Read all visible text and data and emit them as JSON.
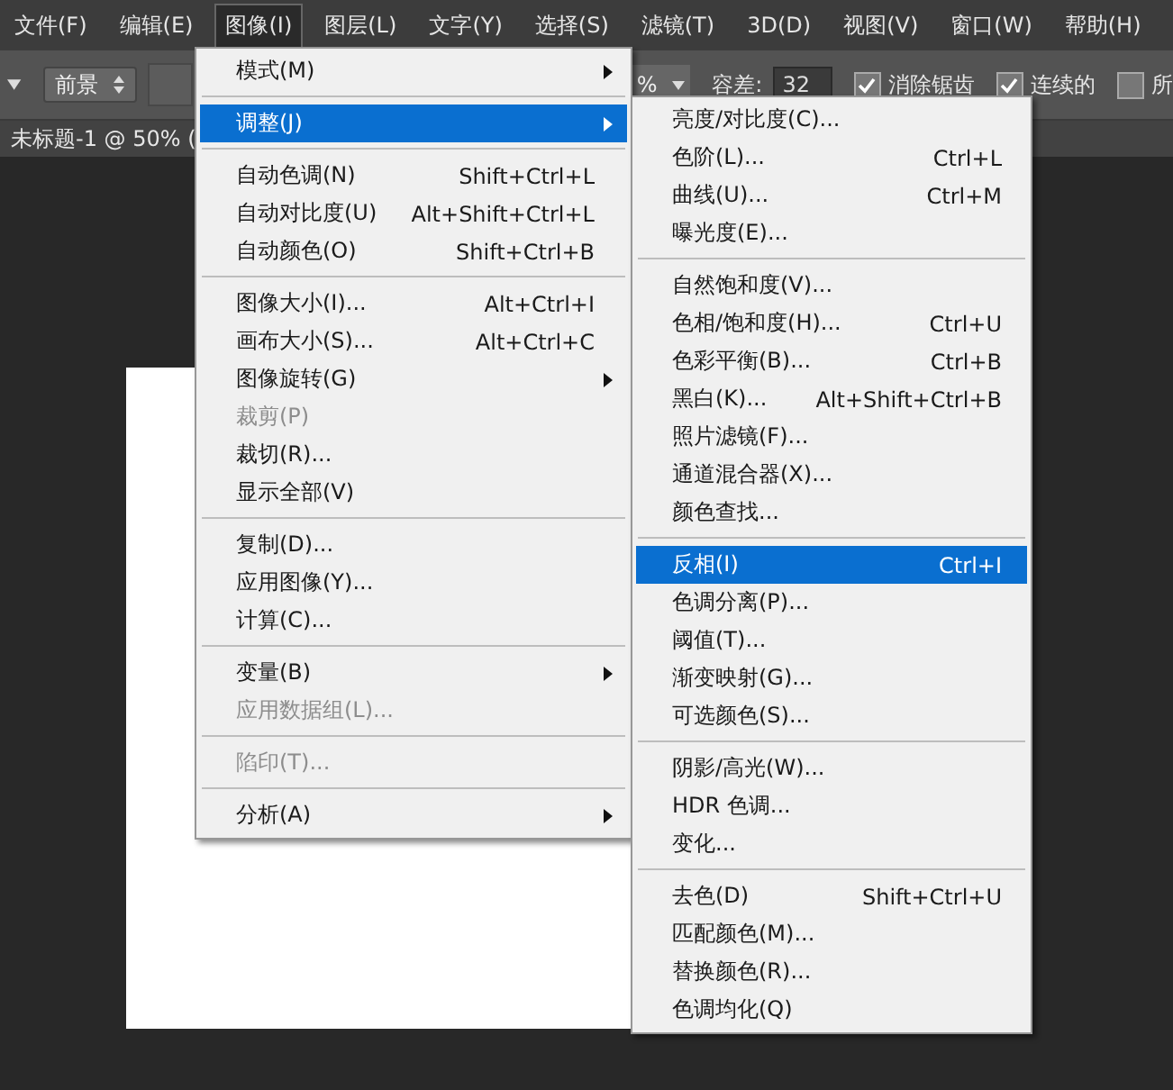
{
  "menubar": [
    {
      "label": "文件(F)",
      "selected": false
    },
    {
      "label": "编辑(E)",
      "selected": false
    },
    {
      "label": "图像(I)",
      "selected": true
    },
    {
      "label": "图层(L)",
      "selected": false
    },
    {
      "label": "文字(Y)",
      "selected": false
    },
    {
      "label": "选择(S)",
      "selected": false
    },
    {
      "label": "滤镜(T)",
      "selected": false
    },
    {
      "label": "3D(D)",
      "selected": false
    },
    {
      "label": "视图(V)",
      "selected": false
    },
    {
      "label": "窗口(W)",
      "selected": false
    },
    {
      "label": "帮助(H)",
      "selected": false
    }
  ],
  "options_bar": {
    "source": "前景",
    "percent": "%",
    "tolerance_label": "容差:",
    "tolerance": "32",
    "checkboxes": [
      {
        "label": "消除锯齿",
        "checked": true
      },
      {
        "label": "连续的",
        "checked": true
      },
      {
        "label": "所",
        "checked": false
      }
    ]
  },
  "document_tab": {
    "title": "未标题-1 @ 50% ("
  },
  "image_menu": [
    {
      "kind": "item",
      "label": "模式(M)",
      "submenu": true,
      "disabled": false,
      "selected": false
    },
    {
      "kind": "separator"
    },
    {
      "kind": "item",
      "label": "调整(J)",
      "submenu": true,
      "disabled": false,
      "selected": true
    },
    {
      "kind": "separator"
    },
    {
      "kind": "item",
      "label": "自动色调(N)",
      "shortcut": "Shift+Ctrl+L",
      "disabled": false,
      "selected": false
    },
    {
      "kind": "item",
      "label": "自动对比度(U)",
      "shortcut": "Alt+Shift+Ctrl+L",
      "disabled": false,
      "selected": false
    },
    {
      "kind": "item",
      "label": "自动颜色(O)",
      "shortcut": "Shift+Ctrl+B",
      "disabled": false,
      "selected": false
    },
    {
      "kind": "separator"
    },
    {
      "kind": "item",
      "label": "图像大小(I)...",
      "shortcut": "Alt+Ctrl+I",
      "disabled": false,
      "selected": false
    },
    {
      "kind": "item",
      "label": "画布大小(S)...",
      "shortcut": "Alt+Ctrl+C",
      "disabled": false,
      "selected": false
    },
    {
      "kind": "item",
      "label": "图像旋转(G)",
      "submenu": true,
      "disabled": false,
      "selected": false
    },
    {
      "kind": "item",
      "label": "裁剪(P)",
      "disabled": true,
      "selected": false
    },
    {
      "kind": "item",
      "label": "裁切(R)...",
      "disabled": false,
      "selected": false
    },
    {
      "kind": "item",
      "label": "显示全部(V)",
      "disabled": false,
      "selected": false
    },
    {
      "kind": "separator"
    },
    {
      "kind": "item",
      "label": "复制(D)...",
      "disabled": false,
      "selected": false
    },
    {
      "kind": "item",
      "label": "应用图像(Y)...",
      "disabled": false,
      "selected": false
    },
    {
      "kind": "item",
      "label": "计算(C)...",
      "disabled": false,
      "selected": false
    },
    {
      "kind": "separator"
    },
    {
      "kind": "item",
      "label": "变量(B)",
      "submenu": true,
      "disabled": false,
      "selected": false
    },
    {
      "kind": "item",
      "label": "应用数据组(L)...",
      "disabled": true,
      "selected": false
    },
    {
      "kind": "separator"
    },
    {
      "kind": "item",
      "label": "陷印(T)...",
      "disabled": true,
      "selected": false
    },
    {
      "kind": "separator"
    },
    {
      "kind": "item",
      "label": "分析(A)",
      "submenu": true,
      "disabled": false,
      "selected": false
    }
  ],
  "adjust_menu": [
    {
      "kind": "item",
      "label": "亮度/对比度(C)...",
      "selected": false
    },
    {
      "kind": "item",
      "label": "色阶(L)...",
      "shortcut": "Ctrl+L",
      "selected": false
    },
    {
      "kind": "item",
      "label": "曲线(U)...",
      "shortcut": "Ctrl+M",
      "selected": false
    },
    {
      "kind": "item",
      "label": "曝光度(E)...",
      "selected": false
    },
    {
      "kind": "separator"
    },
    {
      "kind": "item",
      "label": "自然饱和度(V)...",
      "selected": false
    },
    {
      "kind": "item",
      "label": "色相/饱和度(H)...",
      "shortcut": "Ctrl+U",
      "selected": false
    },
    {
      "kind": "item",
      "label": "色彩平衡(B)...",
      "shortcut": "Ctrl+B",
      "selected": false
    },
    {
      "kind": "item",
      "label": "黑白(K)...",
      "shortcut": "Alt+Shift+Ctrl+B",
      "selected": false
    },
    {
      "kind": "item",
      "label": "照片滤镜(F)...",
      "selected": false
    },
    {
      "kind": "item",
      "label": "通道混合器(X)...",
      "selected": false
    },
    {
      "kind": "item",
      "label": "颜色查找...",
      "selected": false
    },
    {
      "kind": "separator"
    },
    {
      "kind": "item",
      "label": "反相(I)",
      "shortcut": "Ctrl+I",
      "selected": true
    },
    {
      "kind": "item",
      "label": "色调分离(P)...",
      "selected": false
    },
    {
      "kind": "item",
      "label": "阈值(T)...",
      "selected": false
    },
    {
      "kind": "item",
      "label": "渐变映射(G)...",
      "selected": false
    },
    {
      "kind": "item",
      "label": "可选颜色(S)...",
      "selected": false
    },
    {
      "kind": "separator"
    },
    {
      "kind": "item",
      "label": "阴影/高光(W)...",
      "selected": false
    },
    {
      "kind": "item",
      "label": "HDR 色调...",
      "selected": false
    },
    {
      "kind": "item",
      "label": "变化...",
      "selected": false
    },
    {
      "kind": "separator"
    },
    {
      "kind": "item",
      "label": "去色(D)",
      "shortcut": "Shift+Ctrl+U",
      "selected": false
    },
    {
      "kind": "item",
      "label": "匹配颜色(M)...",
      "selected": false
    },
    {
      "kind": "item",
      "label": "替换颜色(R)...",
      "selected": false
    },
    {
      "kind": "item",
      "label": "色调均化(Q)",
      "selected": false
    }
  ]
}
